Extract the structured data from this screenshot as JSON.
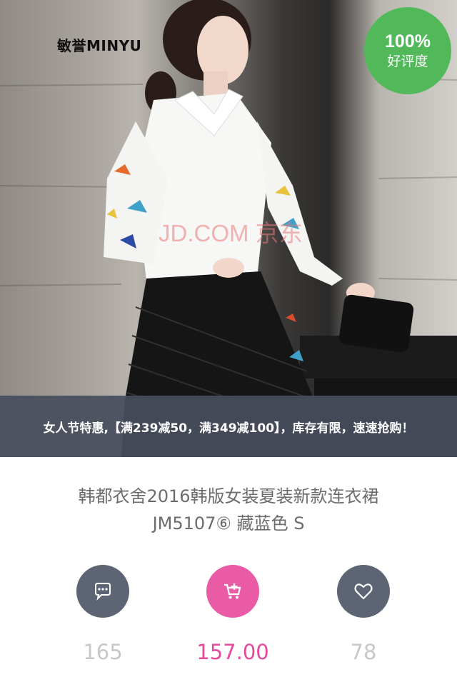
{
  "hero": {
    "brand": "敏誉MINYU",
    "watermark": "JD.COM 京东"
  },
  "rating": {
    "value": "100%",
    "label": "好评度",
    "color": "#52b95a"
  },
  "promo": {
    "text": "女人节特惠,【满239减50，满349减100】，库存有限，速速抢购！"
  },
  "product": {
    "title_line1": "韩都衣舍2016韩版女装夏装新款连衣裙",
    "title_line2": "JM5107⑥ 藏蓝色 S"
  },
  "actions": {
    "comment": {
      "icon": "comment-icon",
      "count": "165",
      "color": "#5d6474"
    },
    "cart": {
      "icon": "add-to-cart-icon",
      "price": "157.00",
      "color": "#ea5ba5"
    },
    "favorite": {
      "icon": "heart-icon",
      "count": "78",
      "color": "#5d6474"
    }
  }
}
